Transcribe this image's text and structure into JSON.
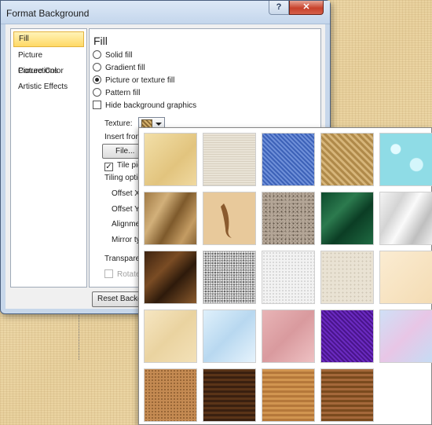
{
  "dialog": {
    "title": "Format Background",
    "help_label": "?",
    "close_label": "✕"
  },
  "nav": {
    "items": [
      {
        "label": "Fill",
        "selected": true
      },
      {
        "label": "Picture Corrections"
      },
      {
        "label": "Picture Color"
      },
      {
        "label": "Artistic Effects"
      }
    ]
  },
  "fill": {
    "heading": "Fill",
    "options": [
      {
        "label": "Solid fill",
        "selected": false
      },
      {
        "label": "Gradient fill",
        "selected": false
      },
      {
        "label": "Picture or texture fill",
        "selected": true
      },
      {
        "label": "Pattern fill",
        "selected": false
      }
    ],
    "hide_background_graphics": "Hide background graphics",
    "texture_label": "Texture:",
    "insert_from_label": "Insert from",
    "file_button": "File...",
    "tile_label": "Tile pic",
    "tiling_options_label": "Tiling option",
    "offset_x_label": "Offset X:",
    "offset_y_label": "Offset Y:",
    "alignment_label": "Alignment",
    "mirror_type_label": "Mirror typ",
    "transparency_label": "Transparen",
    "rotate_label": "Rotate",
    "reset_button": "Reset Backgro"
  },
  "gallery": {
    "textures": [
      {
        "name": "Papyrus"
      },
      {
        "name": "Canvas"
      },
      {
        "name": "Denim"
      },
      {
        "name": "Woven mat"
      },
      {
        "name": "Water droplets"
      },
      {
        "name": "Paper bag"
      },
      {
        "name": "Fish fossil"
      },
      {
        "name": "Sand"
      },
      {
        "name": "Green marble"
      },
      {
        "name": "White marble"
      },
      {
        "name": "Brown marble"
      },
      {
        "name": "Granite"
      },
      {
        "name": "Newsprint"
      },
      {
        "name": "Recycled paper"
      },
      {
        "name": "Parchment"
      },
      {
        "name": "Stationery"
      },
      {
        "name": "Blue tissue paper"
      },
      {
        "name": "Pink tissue paper"
      },
      {
        "name": "Purple mesh"
      },
      {
        "name": "Bouquet"
      },
      {
        "name": "Cork"
      },
      {
        "name": "Walnut"
      },
      {
        "name": "Oak"
      },
      {
        "name": "Medium wood"
      }
    ]
  }
}
